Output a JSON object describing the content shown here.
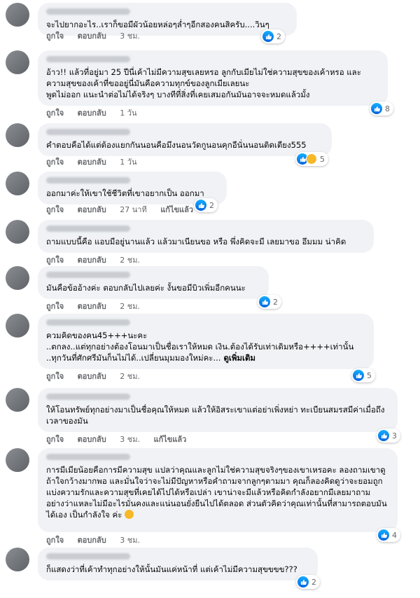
{
  "labels": {
    "like": "ถูกใจ",
    "reply": "ตอบกลับ",
    "edited": "แก้ไขแล้ว",
    "see_more": "ดูเพิ่มเติม"
  },
  "colors": {
    "bubble": "#f0f2f5",
    "like_blue": "#1877f2",
    "meta_gray": "#65676b"
  },
  "comments": [
    {
      "text": "จะไปยากอะไร..เราก็ขอมีผัวน้อยหล่อๆล่ำๆอีกสองคนสิครับ....วินๆ",
      "time": "3 ชม.",
      "reactions": "2"
    },
    {
      "text": "อ้าว!! แล้วที่อยู่มา 25 ปีนี่เค้าไม่มีความสุขเลยหรอ ลูกกับเมียไม่ใช่ความสุขของเค้าหรอ และความสุขของเค้าที่ขออยู่นี่มันคือความทุกข์ของลูกเมียเลยนะ\nพูดไม่ออก แนะนำต่อไม่ได้จริงๆ บางทีที่สิ่งที่เคยเสมอกันมันอาจจะหมดแล้วมั้ง",
      "time": "1 วัน",
      "reactions": "8"
    },
    {
      "text": "คำตอบคือได้แต่ต้องแยกกันนอนคือมึงนอนวัดกูนอนคุกอีนั่นนอนติดเตียง555",
      "time": "1 วัน",
      "reactions": "5"
    },
    {
      "text": "ออกมาค่ะให้เขาใช้ชีวิตที่เขาอยากเป็น ออกมา",
      "time": "27 นาที",
      "reactions": "2",
      "edited": true
    },
    {
      "text": "ถามแบบนี้คือ แอบมีอยู่นานแล้ว แล้วมาเนียนขอ หรือ พึ่งคิดจะมี เลยมาขอ อึมมม น่าคิด",
      "time": "2 ชม.",
      "reactions": ""
    },
    {
      "text": "มันคือข้ออ้างค่ะ ตอบกลับไปเลยค่ะ งั้นขอมีบิวเพิ่มอีกคนนะ",
      "time": "2 ชม.",
      "reactions": "2"
    },
    {
      "text": "ควมคิดของคน45+++นะคะ\n..ตกลง..แต่ทุกอย่างต้องโอนมาเป็นชื่อเราให้หมด เงิน.ต้องได้รับเท่าเดิมหรือ++++เท่านั้น\n..ทุกวันที่ศักศรีมันก็นไม่ได้..เปลี่ยนมุมมองใหม่คะ...",
      "time": "2 ชม.",
      "reactions": "5",
      "see_more": true
    },
    {
      "text": "ให้โอนทรัพย์ทุกอย่างมาเป็นชื่อคุณให้หมด แล้วให้อิสระเขาแต่อย่าเพิ่งหย่า ทะเบียนสมรสมีค่าเมื่อถึงเวลาของมัน",
      "time": "3 ชม.",
      "reactions": "3",
      "edited": true
    },
    {
      "text": "การมีเมียน้อยคือการมีความสุข แปลว่าคุณและลูกไม่ใช่ความสุขจริงๆของเขาเหรอคะ ลองถามเขาดู ถ้าใจกว้างมากพอ และมั่นใจว่าจะไม่มีปัญหาหรือคำถามจากลูกๆตามมา คุณก็ลองคิดดูว่าจะยอมถูกแบ่งความรักและความสุขที่เคยได้ไปได้หรือเปล่า เขาน่าจะมีแล้วหรือคิดกำลังอยากมีเลยมาถาม อย่างว่าแหละไม่มีอะไรมั่นคงและแน่นอนยั่งยืนไปได้ตลอด ส่วนตัวคิดว่าคุณเท่านั้นที่สามารถตอบมันได้เอง เป็นกำลังใจ ค่ะ",
      "time": "3 ชม.",
      "reactions": "4",
      "emoji": true
    },
    {
      "text": "ก็แสดงว่าที่เค้าทำทุกอย่างให้นั้นมันแค่หน้าที่ แต่เค้าไม่มีความสุขขขข???",
      "time": "",
      "reactions": "2"
    }
  ]
}
